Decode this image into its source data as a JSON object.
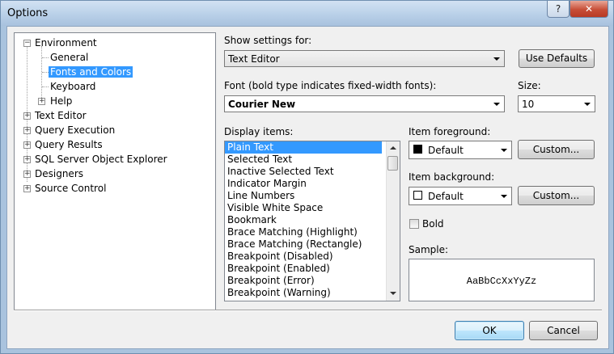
{
  "window": {
    "title": "Options",
    "help_label": "?",
    "close_label": "✕"
  },
  "tree": {
    "items": [
      {
        "label": "Environment",
        "expander": "−"
      },
      {
        "label": "General"
      },
      {
        "label": "Fonts and Colors"
      },
      {
        "label": "Keyboard"
      },
      {
        "label": "Help",
        "expander": "+"
      },
      {
        "label": "Text Editor",
        "expander": "+"
      },
      {
        "label": "Query Execution",
        "expander": "+"
      },
      {
        "label": "Query Results",
        "expander": "+"
      },
      {
        "label": "SQL Server Object Explorer",
        "expander": "+"
      },
      {
        "label": "Designers",
        "expander": "+"
      },
      {
        "label": "Source Control",
        "expander": "+"
      }
    ],
    "selected": "Fonts and Colors"
  },
  "settings": {
    "show_settings_label": "Show settings for:",
    "show_settings_value": "Text Editor",
    "use_defaults_label": "Use Defaults",
    "font_label": "Font (bold type indicates fixed-width fonts):",
    "font_value": "Courier New",
    "size_label": "Size:",
    "size_value": "10"
  },
  "display_items": {
    "label": "Display items:",
    "items": [
      "Plain Text",
      "Selected Text",
      "Inactive Selected Text",
      "Indicator Margin",
      "Line Numbers",
      "Visible White Space",
      "Bookmark",
      "Brace Matching (Highlight)",
      "Brace Matching (Rectangle)",
      "Breakpoint (Disabled)",
      "Breakpoint (Enabled)",
      "Breakpoint (Error)",
      "Breakpoint (Warning)"
    ],
    "selected": "Plain Text"
  },
  "item_foreground": {
    "label": "Item foreground:",
    "value": "Default",
    "swatch_color": "#000000",
    "custom_label": "Custom..."
  },
  "item_background": {
    "label": "Item background:",
    "value": "Default",
    "swatch_color": "#ffffff",
    "custom_label": "Custom..."
  },
  "bold": {
    "label": "Bold",
    "checked": false
  },
  "sample": {
    "label": "Sample:",
    "text": "AaBbCcXxYyZz"
  },
  "footer": {
    "ok_label": "OK",
    "cancel_label": "Cancel"
  }
}
